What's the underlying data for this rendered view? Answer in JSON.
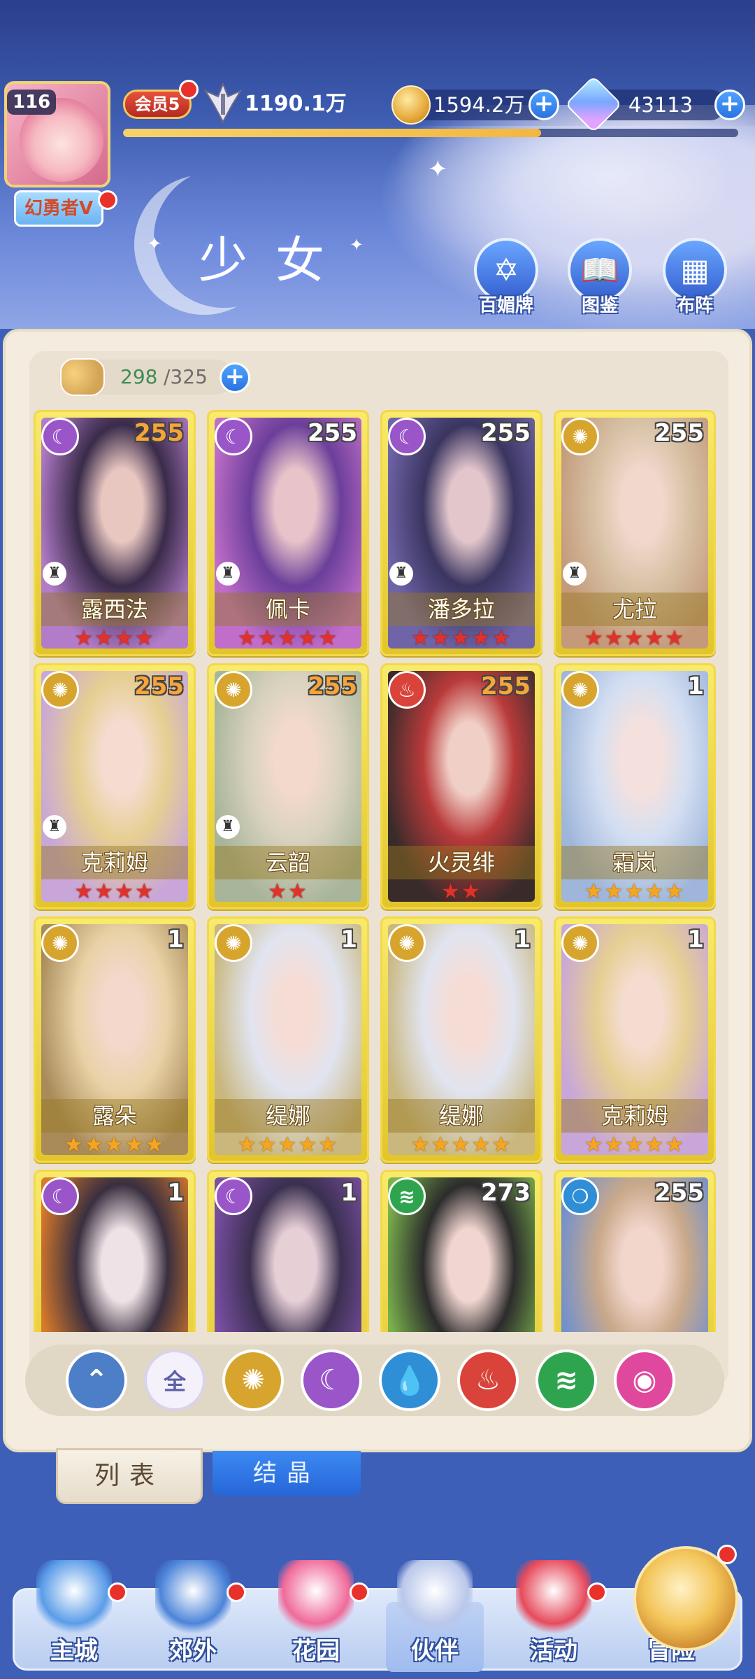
{
  "header": {
    "avatar_level": "116",
    "hero_name": "幻勇者V",
    "vip_label": "会员5",
    "power": "1190.1万",
    "exp_fraction": 0.68,
    "coins": "1594.2万",
    "gems": "43113",
    "page_title": "少女",
    "buttons": [
      "百媚牌",
      "图鉴",
      "布阵"
    ]
  },
  "roster": {
    "current": "298",
    "max": "/325"
  },
  "cards": [
    {
      "name": "露西法",
      "level": "255",
      "element": "moon",
      "stars": 4,
      "star_color": "red",
      "level_color": "orange",
      "job": true
    },
    {
      "name": "佩卡",
      "level": "255",
      "element": "moon",
      "stars": 5,
      "star_color": "red",
      "level_color": "white",
      "job": true
    },
    {
      "name": "潘多拉",
      "level": "255",
      "element": "moon",
      "stars": 5,
      "star_color": "red",
      "level_color": "white",
      "job": true
    },
    {
      "name": "尤拉",
      "level": "255",
      "element": "sun",
      "stars": 5,
      "star_color": "red",
      "level_color": "white",
      "job": true
    },
    {
      "name": "克莉姆",
      "level": "255",
      "element": "sun",
      "stars": 4,
      "star_color": "red",
      "level_color": "orange",
      "job": true
    },
    {
      "name": "云韶",
      "level": "255",
      "element": "sun",
      "stars": 2,
      "star_color": "red",
      "level_color": "orange",
      "job": true
    },
    {
      "name": "火灵绯",
      "level": "255",
      "element": "fire",
      "stars": 2,
      "star_color": "red",
      "level_color": "orange",
      "job": false
    },
    {
      "name": "霜岚",
      "level": "1",
      "element": "sun",
      "stars": 5,
      "star_color": "gold",
      "level_color": "white",
      "job": false
    },
    {
      "name": "露朵",
      "level": "1",
      "element": "sun",
      "stars": 5,
      "star_color": "gold",
      "level_color": "white",
      "job": false
    },
    {
      "name": "缇娜",
      "level": "1",
      "element": "sun",
      "stars": 5,
      "star_color": "gold",
      "level_color": "white",
      "job": false
    },
    {
      "name": "缇娜",
      "level": "1",
      "element": "sun",
      "stars": 5,
      "star_color": "gold",
      "level_color": "white",
      "job": false
    },
    {
      "name": "克莉姆",
      "level": "1",
      "element": "sun",
      "stars": 5,
      "star_color": "gold",
      "level_color": "white",
      "job": false
    },
    {
      "name": "",
      "level": "1",
      "element": "moon",
      "stars": 0,
      "star_color": "gold",
      "level_color": "white",
      "job": false
    },
    {
      "name": "",
      "level": "1",
      "element": "moon",
      "stars": 0,
      "star_color": "gold",
      "level_color": "white",
      "job": false
    },
    {
      "name": "",
      "level": "273",
      "element": "wind",
      "stars": 0,
      "star_color": "gold",
      "level_color": "white",
      "job": false
    },
    {
      "name": "",
      "level": "255",
      "element": "water",
      "stars": 0,
      "star_color": "gold",
      "level_color": "white",
      "job": false
    }
  ],
  "filters": [
    {
      "id": "up",
      "label": "",
      "color": "#4d7fc8",
      "icon": "chevron-up-icon"
    },
    {
      "id": "all",
      "label": "全",
      "color": "#f4f1fb",
      "icon": "all-icon"
    },
    {
      "id": "sun",
      "label": "",
      "color": "#d7a52e",
      "icon": "sun-icon"
    },
    {
      "id": "moon",
      "label": "",
      "color": "#9a55c9",
      "icon": "moon-icon"
    },
    {
      "id": "water",
      "label": "",
      "color": "#2f8fd6",
      "icon": "water-icon"
    },
    {
      "id": "fire",
      "label": "",
      "color": "#d9433a",
      "icon": "fire-icon"
    },
    {
      "id": "wind",
      "label": "",
      "color": "#2fa44e",
      "icon": "wind-icon"
    },
    {
      "id": "light",
      "label": "",
      "color": "#e0489d",
      "icon": "light-icon"
    }
  ],
  "tabs": {
    "list": "列表",
    "crystal": "结晶"
  },
  "nav": [
    "主城",
    "郊外",
    "花园",
    "伙伴",
    "活动",
    "冒险"
  ],
  "element_colors": {
    "moon": "#9a55c9",
    "sun": "#d7a52e",
    "fire": "#d9433a",
    "wind": "#2fa44e",
    "water": "#2f8fd6"
  },
  "element_glyphs": {
    "moon": "☾",
    "sun": "✺",
    "fire": "♨",
    "wind": "≋",
    "water": "❍"
  }
}
